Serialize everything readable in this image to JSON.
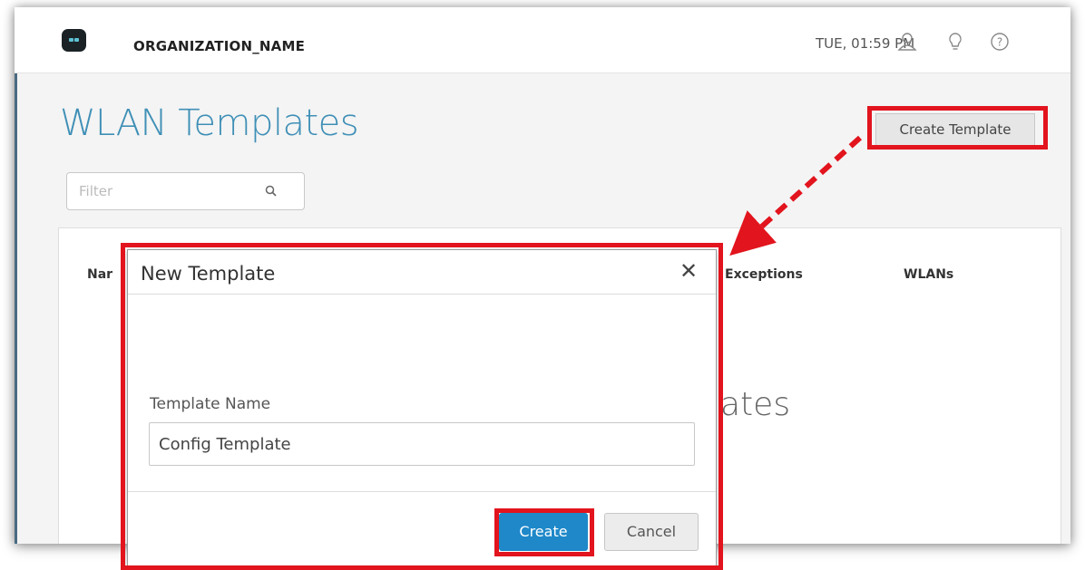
{
  "header": {
    "org_name": "ORGANIZATION_NAME",
    "clock": "TUE, 01:59 PM",
    "icons": [
      "user-icon",
      "lightbulb-icon",
      "help-icon"
    ]
  },
  "page": {
    "title": "WLAN Templates",
    "create_template_label": "Create Template",
    "filter_placeholder": "Filter"
  },
  "table": {
    "columns": [
      "Nar",
      "Exceptions",
      "WLANs"
    ],
    "empty_text_fragment": "ates"
  },
  "dialog": {
    "title": "New Template",
    "close_glyph": "✕",
    "field_label": "Template Name",
    "field_value": "Config Template",
    "create_label": "Create",
    "cancel_label": "Cancel"
  },
  "colors": {
    "highlight": "#e2141d",
    "title_blue": "#3f8fb6",
    "primary_button": "#1e88c9"
  }
}
